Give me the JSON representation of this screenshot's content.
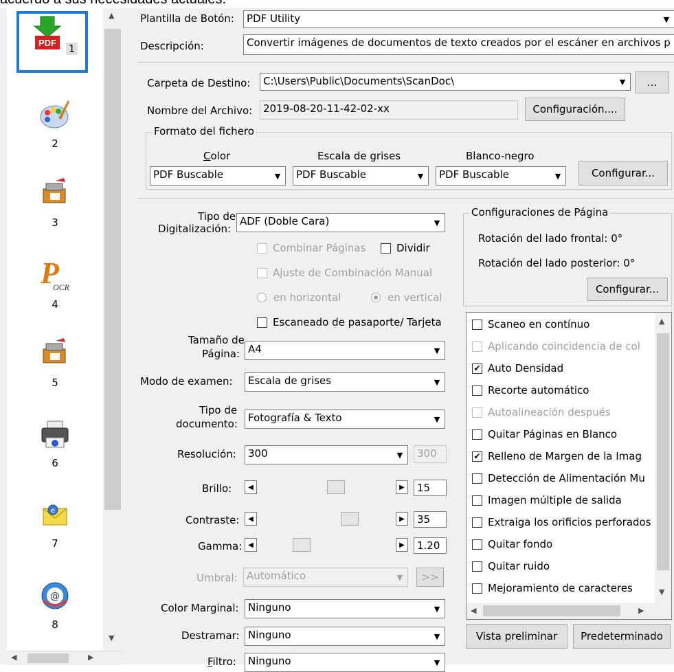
{
  "top_text": "acuerdo a sus necesidades actuales.",
  "sidebar": {
    "items": [
      {
        "num": "1",
        "icon": "pdf-icon"
      },
      {
        "num": "2",
        "icon": "palette-icon"
      },
      {
        "num": "3",
        "icon": "scanner-icon"
      },
      {
        "num": "4",
        "icon": "ocr-icon"
      },
      {
        "num": "5",
        "icon": "scanner-icon"
      },
      {
        "num": "6",
        "icon": "printer-icon"
      },
      {
        "num": "7",
        "icon": "email-icon"
      },
      {
        "num": "8",
        "icon": "web-icon"
      }
    ]
  },
  "header": {
    "template_label": "Plantilla de Botón:",
    "template_value": "PDF Utility",
    "desc_label": "Descripción:",
    "desc_value": "Convertir imágenes de documentos de texto creados por el escáner en archivos p"
  },
  "dest": {
    "folder_label": "Carpeta de Destino:",
    "folder_value": "C:\\Users\\Public\\Documents\\ScanDoc\\",
    "browse_label": "...",
    "filename_label": "Nombre del Archivo:",
    "filename_value": "2019-08-20-11-42-02-xx",
    "config_button": "Configuración...."
  },
  "format": {
    "title": "Formato del fichero",
    "color_label": "Color",
    "gray_label": "Escala de grises",
    "bw_label": "Blanco-negro",
    "color_value": "PDF Buscable",
    "gray_value": "PDF Buscable",
    "bw_value": "PDF Buscable",
    "configure_button": "Configurar..."
  },
  "scan": {
    "type_label_1": "Tipo de",
    "type_label_2": "Digitalización:",
    "type_value": "ADF (Doble Cara)",
    "combine_pages": "Combinar Páginas",
    "split": "Dividir",
    "manual_combine": "Ajuste de Combinación Manual",
    "horizontal": "en horizontal",
    "vertical": "en vertical",
    "passport": "Escaneado de pasaporte/ Tarjeta",
    "page_size_label_1": "Tamaño de",
    "page_size_label_2": "Página:",
    "page_size_value": "A4",
    "mode_label": "Modo de examen:",
    "mode_value": "Escala de grises",
    "doc_type_label_1": "Tipo de",
    "doc_type_label_2": "documento:",
    "doc_type_value": "Fotografía & Texto",
    "resolution_label": "Resolución:",
    "resolution_value": "300",
    "resolution_readonly": "300",
    "brightness_label": "Brillo:",
    "brightness_value": "15",
    "contrast_label": "Contraste:",
    "contrast_value": "35",
    "gamma_label": "Gamma:",
    "gamma_value": "1.20",
    "threshold_label": "Umbral:",
    "threshold_value": "Automático",
    "threshold_button": ">>",
    "edge_color_label": "Color Marginal:",
    "edge_color_value": "Ninguno",
    "descreen_label": "Destramar:",
    "descreen_value": "Ninguno",
    "filter_label": "Filtro:",
    "filter_value": "Ninguno"
  },
  "page_config": {
    "title": "Configuraciones de Página",
    "front_rotation": "Rotación del lado frontal: 0°",
    "back_rotation": "Rotación del lado posterior: 0°",
    "configure_button": "Configurar..."
  },
  "options": [
    {
      "label": "Scaneo en contínuo",
      "checked": false,
      "enabled": true
    },
    {
      "label": "Aplicando coincidencia de col",
      "checked": false,
      "enabled": false
    },
    {
      "label": "Auto Densidad",
      "checked": true,
      "enabled": true
    },
    {
      "label": "Recorte automático",
      "checked": false,
      "enabled": true
    },
    {
      "label": "Autoalineación después",
      "checked": false,
      "enabled": false
    },
    {
      "label": "Quitar Páginas en Blanco",
      "checked": false,
      "enabled": true
    },
    {
      "label": "Relleno de Margen de la Imag",
      "checked": true,
      "enabled": true
    },
    {
      "label": "Detección de Alimentación Mu",
      "checked": false,
      "enabled": true
    },
    {
      "label": "Imagen múltiple de salida",
      "checked": false,
      "enabled": true
    },
    {
      "label": "Extraiga los orificios perforados",
      "checked": false,
      "enabled": true
    },
    {
      "label": "Quitar fondo",
      "checked": false,
      "enabled": true
    },
    {
      "label": "Quitar ruido",
      "checked": false,
      "enabled": true
    },
    {
      "label": "Mejoramiento de caracteres",
      "checked": false,
      "enabled": true
    }
  ],
  "bottom": {
    "preview_button": "Vista preliminar",
    "default_button": "Predeterminado"
  }
}
